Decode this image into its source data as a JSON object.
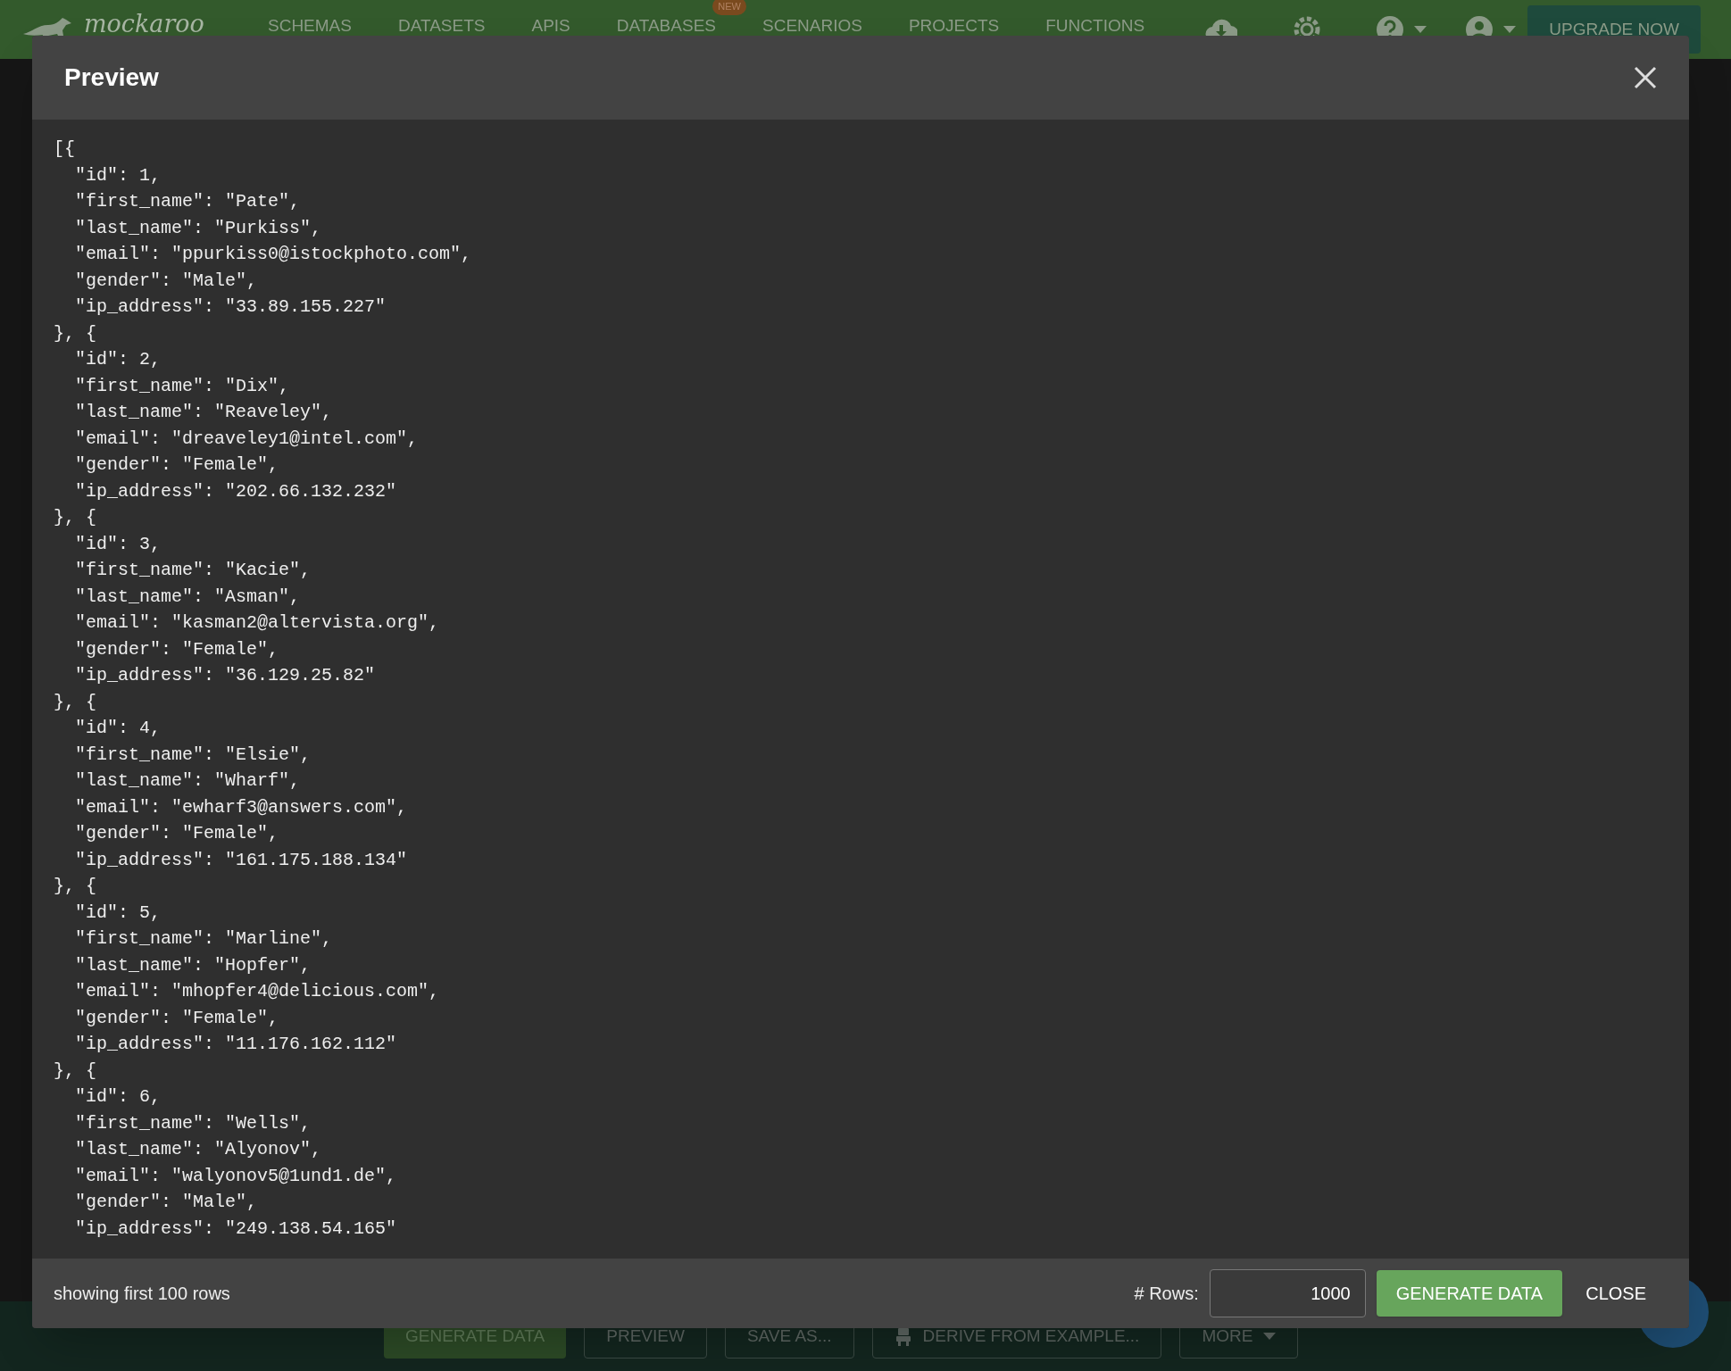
{
  "nav": {
    "logo": "mockaroo",
    "items": [
      {
        "label": "SCHEMAS"
      },
      {
        "label": "DATASETS"
      },
      {
        "label": "APIS"
      },
      {
        "label": "DATABASES",
        "badge": "NEW"
      },
      {
        "label": "SCENARIOS"
      },
      {
        "label": "PROJECTS"
      },
      {
        "label": "FUNCTIONS"
      }
    ],
    "upgrade_button": "UPGRADE NOW"
  },
  "toolbar": [
    {
      "kind": "primary",
      "label": "GENERATE DATA"
    },
    {
      "kind": "plain",
      "label": "PREVIEW"
    },
    {
      "kind": "plain",
      "label": "SAVE AS..."
    },
    {
      "kind": "robot",
      "label": "DERIVE FROM EXAMPLE..."
    },
    {
      "kind": "dropdown",
      "label": "MORE"
    }
  ],
  "modal": {
    "title": "Preview",
    "code_lines": [
      "[{",
      "  \"id\": 1,",
      "  \"first_name\": \"Pate\",",
      "  \"last_name\": \"Purkiss\",",
      "  \"email\": \"ppurkiss0@istockphoto.com\",",
      "  \"gender\": \"Male\",",
      "  \"ip_address\": \"33.89.155.227\"",
      "}, {",
      "  \"id\": 2,",
      "  \"first_name\": \"Dix\",",
      "  \"last_name\": \"Reaveley\",",
      "  \"email\": \"dreaveley1@intel.com\",",
      "  \"gender\": \"Female\",",
      "  \"ip_address\": \"202.66.132.232\"",
      "}, {",
      "  \"id\": 3,",
      "  \"first_name\": \"Kacie\",",
      "  \"last_name\": \"Asman\",",
      "  \"email\": \"kasman2@altervista.org\",",
      "  \"gender\": \"Female\",",
      "  \"ip_address\": \"36.129.25.82\"",
      "}, {",
      "  \"id\": 4,",
      "  \"first_name\": \"Elsie\",",
      "  \"last_name\": \"Wharf\",",
      "  \"email\": \"ewharf3@answers.com\",",
      "  \"gender\": \"Female\",",
      "  \"ip_address\": \"161.175.188.134\"",
      "}, {",
      "  \"id\": 5,",
      "  \"first_name\": \"Marline\",",
      "  \"last_name\": \"Hopfer\",",
      "  \"email\": \"mhopfer4@delicious.com\",",
      "  \"gender\": \"Female\",",
      "  \"ip_address\": \"11.176.162.112\"",
      "}, {",
      "  \"id\": 6,",
      "  \"first_name\": \"Wells\",",
      "  \"last_name\": \"Alyonov\",",
      "  \"email\": \"walyonov5@1und1.de\",",
      "  \"gender\": \"Male\",",
      "  \"ip_address\": \"249.138.54.165\""
    ],
    "footer": {
      "note": "showing first 100 rows",
      "rows_label": "# Rows:",
      "rows_value": "1000",
      "generate_button": "GENERATE DATA",
      "close_button": "CLOSE"
    }
  }
}
